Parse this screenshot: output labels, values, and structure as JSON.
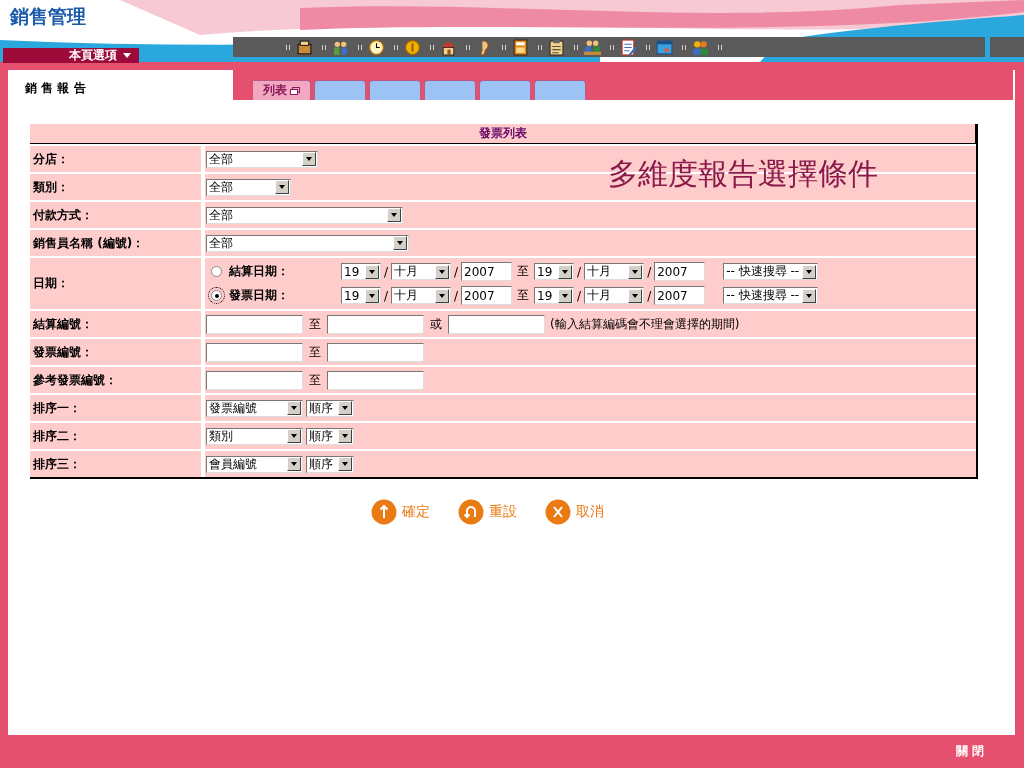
{
  "header": {
    "logo": "銷售管理",
    "menu_button": "本頁選項"
  },
  "page_title": "銷 售 報 告",
  "tabs": [
    {
      "label": "列表",
      "selected": true
    }
  ],
  "form": {
    "title": "發票列表",
    "overlay_note": "多維度報告選擇條件",
    "rows": [
      {
        "kind": "select",
        "label": "分店：",
        "value": "全部"
      },
      {
        "kind": "select",
        "label": "類別：",
        "value": "全部"
      },
      {
        "kind": "select",
        "label": "付款方式：",
        "value": "全部"
      },
      {
        "kind": "select",
        "label": "銷售員名稱 (編號)：",
        "value": "全部"
      },
      {
        "kind": "date",
        "label": "日期：",
        "options": [
          {
            "label": "結算日期：",
            "selected": false,
            "from": {
              "day": "19",
              "month": "十月",
              "year": "2007",
              "separators": [
                "/",
                "/"
              ]
            },
            "to_word": "至",
            "to": {
              "day": "19",
              "month": "十月",
              "year": "2007",
              "separators": [
                "/",
                "/"
              ]
            },
            "quick": "-- 快速搜尋 --"
          },
          {
            "label": "發票日期：",
            "selected": true,
            "from": {
              "day": "19",
              "month": "十月",
              "year": "2007",
              "separators": [
                "/",
                "/"
              ]
            },
            "to_word": "至",
            "to": {
              "day": "19",
              "month": "十月",
              "year": "2007",
              "separators": [
                "/",
                "/"
              ]
            },
            "quick": "-- 快速搜尋 --"
          }
        ]
      },
      {
        "kind": "range",
        "label": "結算編號：",
        "to_word": "至",
        "or_word": "或",
        "note": "(輸入結算編碼會不理會選擇的期間)"
      },
      {
        "kind": "range",
        "label": "發票編號：",
        "to_word": "至"
      },
      {
        "kind": "range",
        "label": "參考發票編號：",
        "to_word": "至"
      },
      {
        "kind": "sort",
        "label": "排序一：",
        "value": "發票編號",
        "order": "順序"
      },
      {
        "kind": "sort",
        "label": "排序二：",
        "value": "類別",
        "order": "順序"
      },
      {
        "kind": "sort",
        "label": "排序三：",
        "value": "會員編號",
        "order": "順序"
      }
    ]
  },
  "buttons": [
    {
      "kind": "confirm",
      "label": "確定"
    },
    {
      "kind": "reset",
      "label": "重設"
    },
    {
      "kind": "cancel",
      "label": "取消"
    }
  ],
  "footer": {
    "close": "關 閉"
  }
}
